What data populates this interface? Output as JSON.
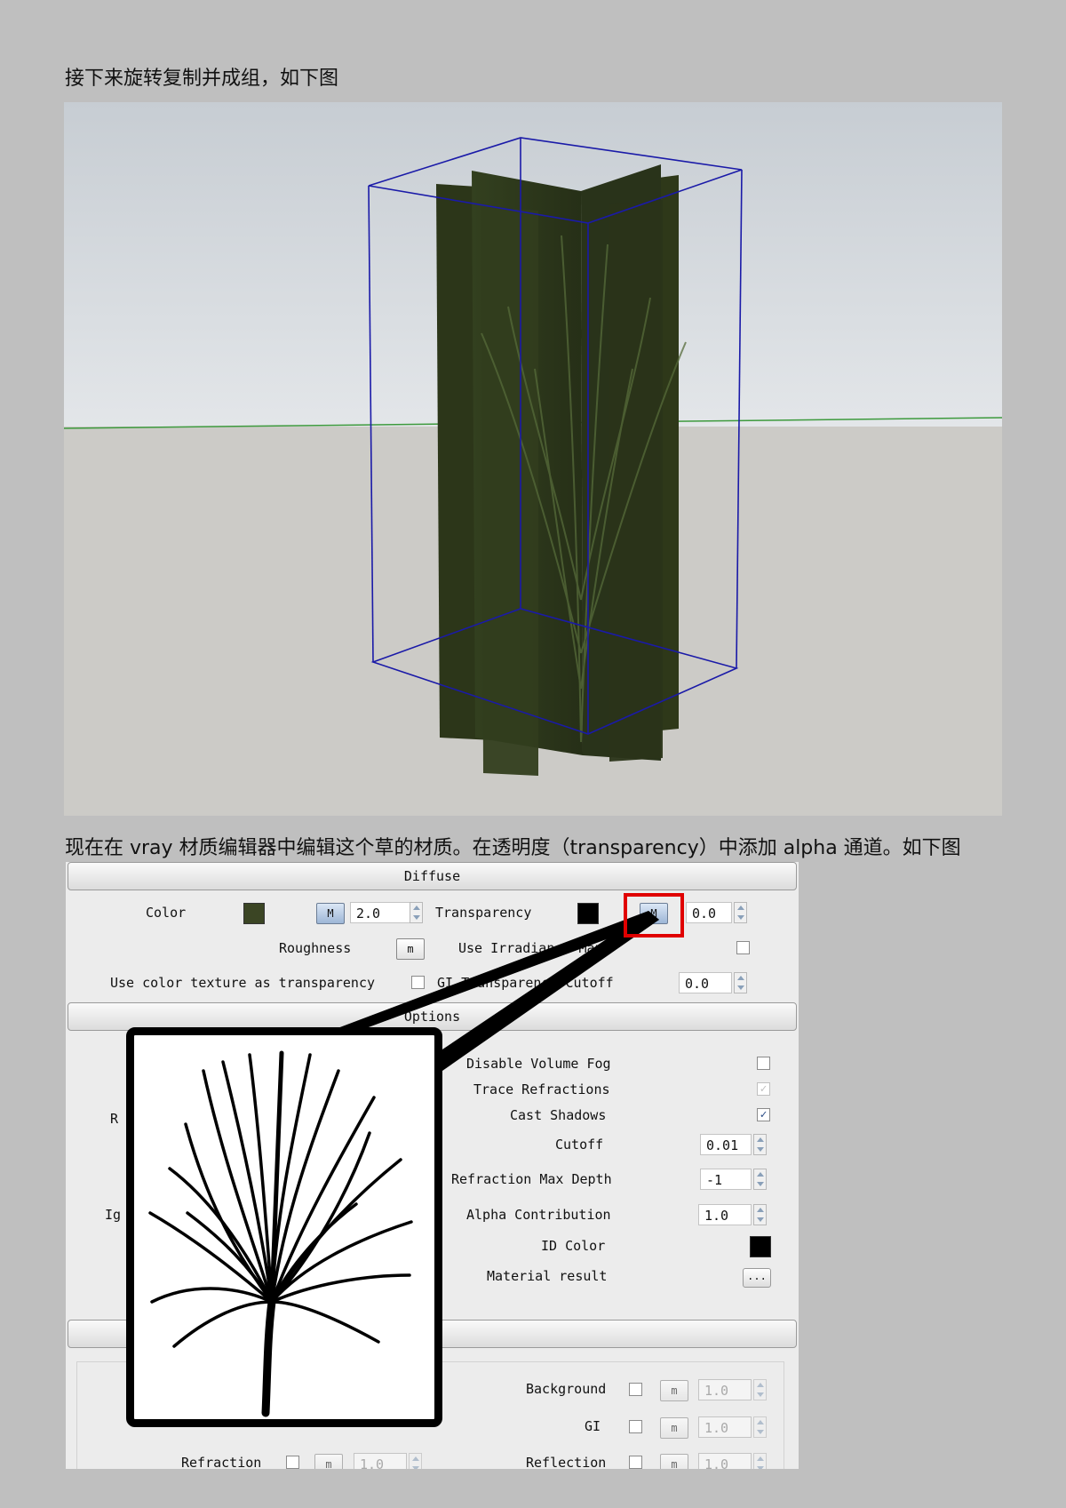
{
  "paragraph_1": "接下来旋转复制并成组，如下图",
  "paragraph_2": "现在在 vray 材质编辑器中编辑这个草的材质。在透明度（transparency）中添加 alpha 通道。如下图",
  "vray": {
    "diffuse_title": "Diffuse",
    "color_label": "Color",
    "color_swatch": "#3b4524",
    "diffuse_map_btn": "M",
    "diffuse_value": "2.0",
    "transparency_label": "Transparency",
    "transparency_swatch": "#000000",
    "transparency_map_btn": "M",
    "transparency_value": "0.0",
    "roughness_label": "Roughness",
    "roughness_btn": "m",
    "use_irradiance_label": "Use Irradiance Map",
    "use_color_texture_label": "Use color texture as transparency",
    "gi_transparency_label": "GI Transparency Cutoff",
    "gi_transparency_value": "0.0",
    "options_title": "Options",
    "disable_volume_fog_label": "Disable Volume Fog",
    "trace_refractions_label": "Trace Refractions",
    "cast_shadows_label": "Cast Shadows",
    "cutoff_label": "Cutoff",
    "cutoff_value": "0.01",
    "refraction_max_depth_label": "Refraction Max Depth",
    "refraction_max_depth_value": "-1",
    "alpha_contribution_label": "Alpha Contribution",
    "alpha_contribution_value": "1.0",
    "id_color_label": "ID Color",
    "id_color_swatch": "#000000",
    "material_result_label": "Material result",
    "material_result_btn": "...",
    "partial_left_1": "R",
    "partial_left_2": "Ig",
    "partial_section_suffix": "s",
    "background_label": "Background",
    "background_btn": "m",
    "background_value": "1.0",
    "gi_label": "GI",
    "gi_btn": "m",
    "gi_value": "1.0",
    "refraction_label": "Refraction",
    "refraction_btn": "m",
    "refraction_value": "1.0",
    "reflection_label": "Reflection",
    "reflection_btn": "m",
    "reflection_value": "1.0",
    "check_mark": "✓"
  },
  "colors": {
    "page_bg": "#bfbfbf",
    "highlight": "#e00000",
    "selection": "#1a1aa8",
    "plane": "#3b4524"
  }
}
